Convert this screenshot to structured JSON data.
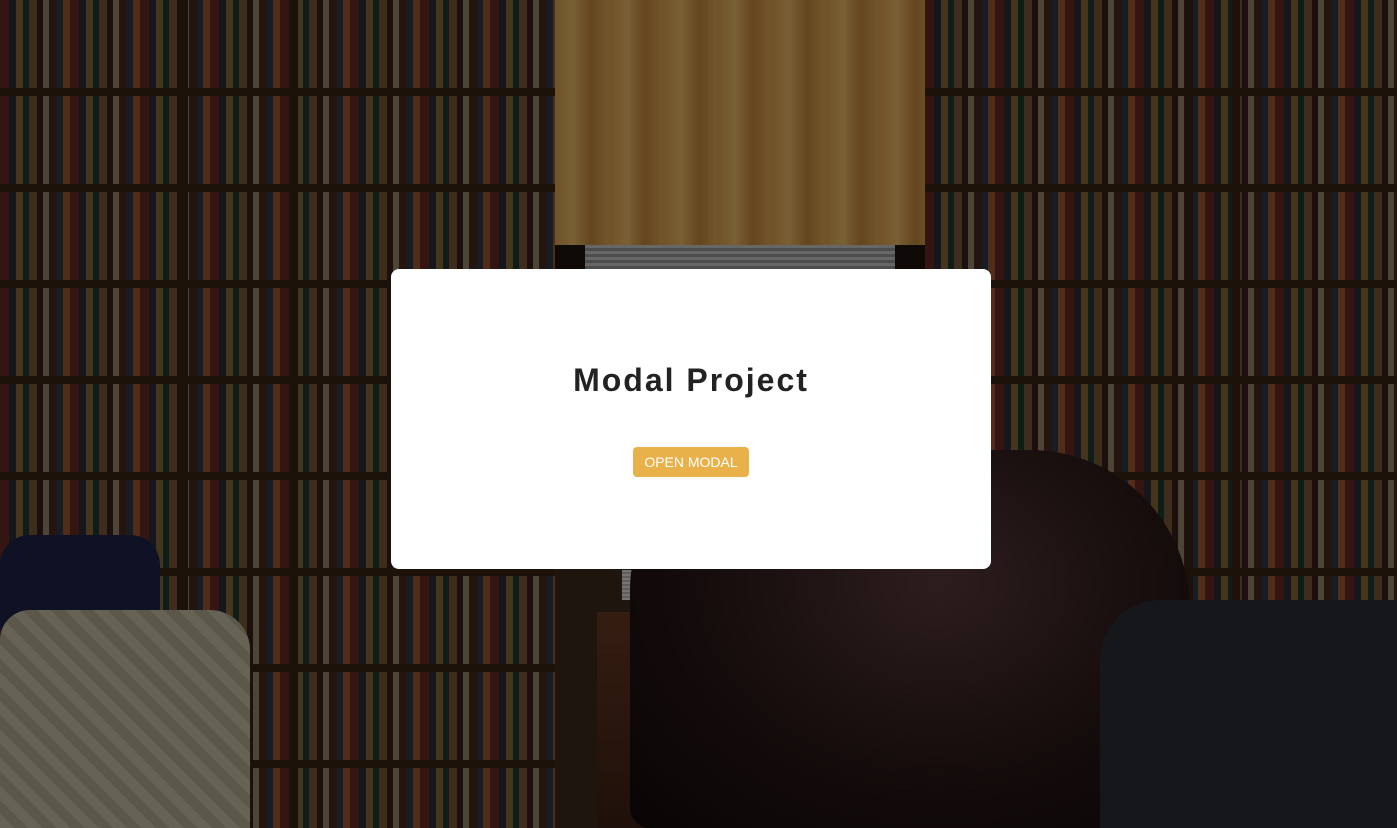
{
  "page": {
    "title": "Modal Project"
  },
  "modal": {
    "open_button_label": "OPEN MODAL"
  },
  "colors": {
    "overlay": "rgba(0,0,0,0.5)",
    "card": "#ffffff",
    "title_text": "#222222",
    "button_bg": "#e8b14a",
    "button_text": "#ffffff"
  }
}
